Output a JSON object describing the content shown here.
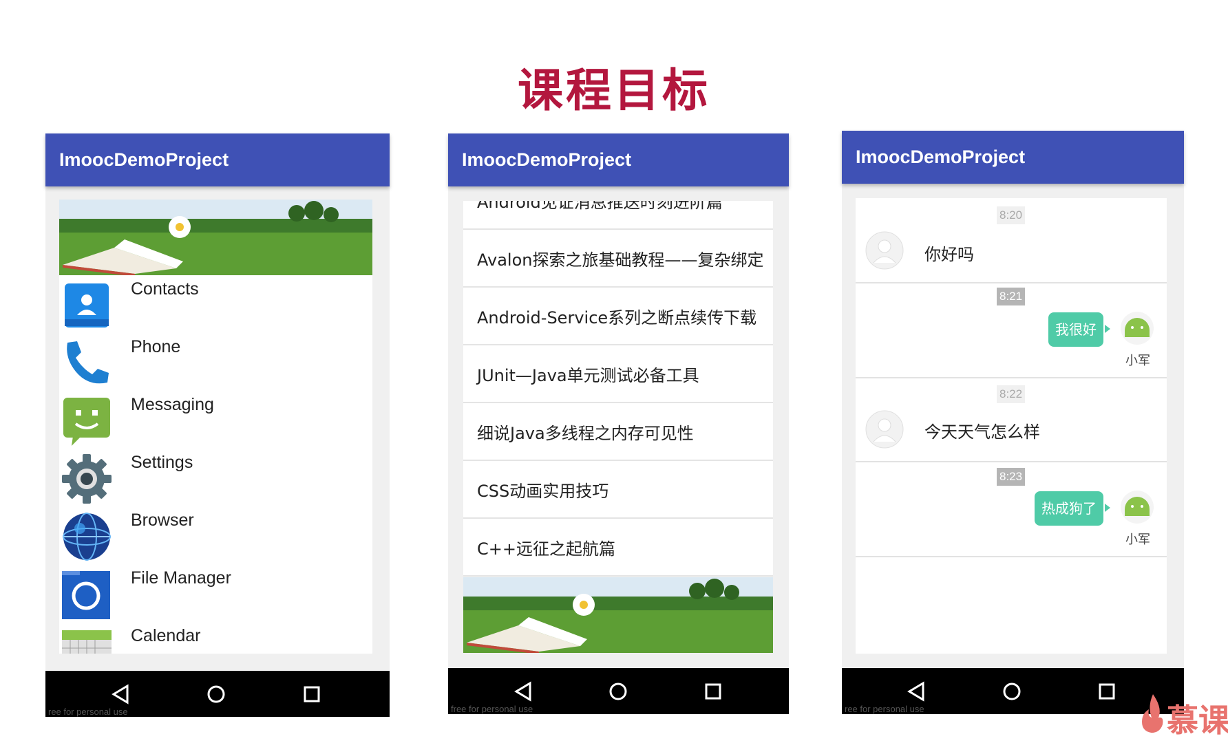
{
  "slide": {
    "title": "课程目标"
  },
  "colors": {
    "app_bar": "#3f51b5",
    "title_red": "#b3173e",
    "bubble_green": "#4fcba7",
    "nav_bar": "#000000"
  },
  "phones": [
    {
      "app_title": "ImoocDemoProject",
      "banner": "book-on-grass-image",
      "apps": [
        {
          "label": "Contacts",
          "icon": "contacts-icon"
        },
        {
          "label": "Phone",
          "icon": "phone-icon"
        },
        {
          "label": "Messaging",
          "icon": "messaging-icon"
        },
        {
          "label": "Settings",
          "icon": "settings-gear-icon"
        },
        {
          "label": "Browser",
          "icon": "browser-globe-icon"
        },
        {
          "label": "File Manager",
          "icon": "file-manager-icon"
        },
        {
          "label": "Calendar",
          "icon": "calendar-icon"
        }
      ],
      "watermark": "ree for personal use"
    },
    {
      "app_title": "ImoocDemoProject",
      "courses": [
        "Android见证消息推送时刻进阶篇",
        "Avalon探索之旅基础教程——复杂绑定",
        "Android-Service系列之断点续传下载",
        "JUnit—Java单元测试必备工具",
        "细说Java多线程之内存可见性",
        "CSS动画实用技巧",
        "C++远征之起航篇"
      ],
      "footer_banner": "book-on-grass-image",
      "watermark": "free for personal use"
    },
    {
      "app_title": "ImoocDemoProject",
      "messages": [
        {
          "time": "8:20",
          "direction": "in",
          "text": "你好吗",
          "avatar": "default-person-avatar-icon"
        },
        {
          "time": "8:21",
          "direction": "out",
          "text": "我很好",
          "sender": "小军",
          "avatar": "android-robot-avatar-icon"
        },
        {
          "time": "8:22",
          "direction": "in",
          "text": "今天天气怎么样",
          "avatar": "default-person-avatar-icon"
        },
        {
          "time": "8:23",
          "direction": "out",
          "text": "热成狗了",
          "sender": "小军",
          "avatar": "android-robot-avatar-icon"
        }
      ],
      "watermark": "ree for personal use"
    }
  ],
  "nav_icons": [
    "back-triangle-icon",
    "home-circle-icon",
    "recents-square-icon"
  ],
  "brand": {
    "text": "慕课"
  }
}
